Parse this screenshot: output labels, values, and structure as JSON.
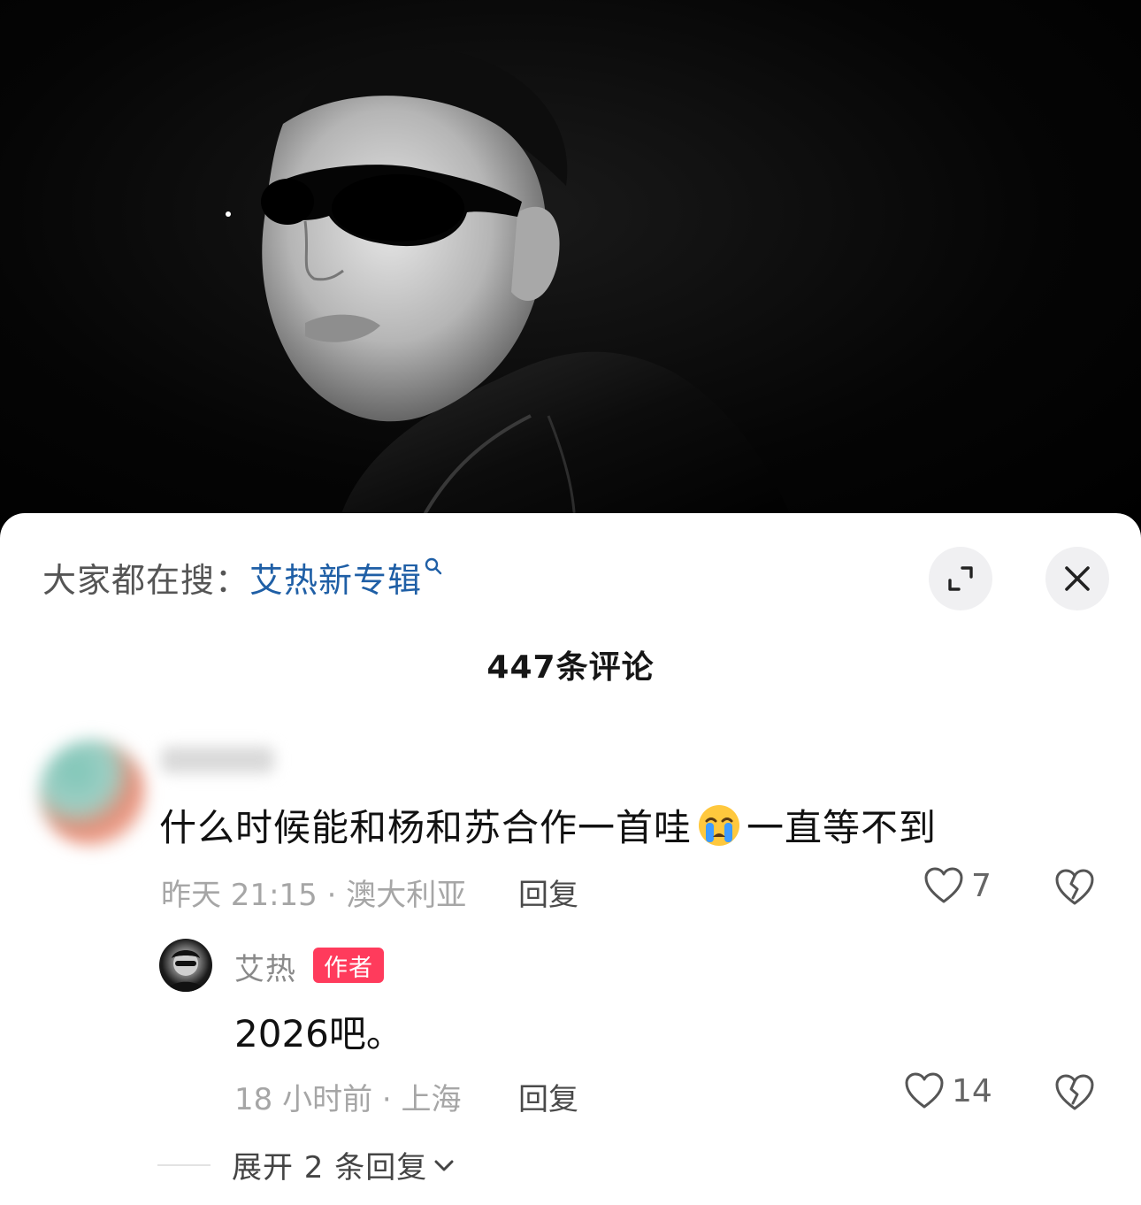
{
  "header": {
    "search_prefix": "大家都在搜：",
    "search_term": "艾热新专辑",
    "comment_count": "447条评论"
  },
  "comments": [
    {
      "text_before_emoji": "什么时候能和杨和苏合作一首哇",
      "emoji": "loudly-crying-face",
      "text_after_emoji": "一直等不到",
      "meta": "昨天 21:15 · 澳大利亚",
      "reply_label": "回复",
      "likes": "7",
      "replies": [
        {
          "username": "艾热",
          "badge": "作者",
          "text": "2026吧。",
          "meta": "18 小时前 · 上海",
          "reply_label": "回复",
          "likes": "14"
        }
      ],
      "expand_label": "展开 2 条回复"
    }
  ],
  "colors": {
    "search_term": "#1f5fa6",
    "author_badge": "#ff3b5c"
  }
}
